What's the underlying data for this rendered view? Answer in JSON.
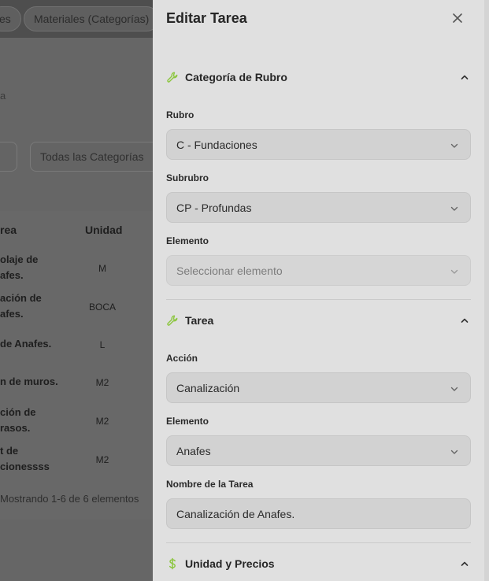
{
  "background": {
    "tabs": [
      "es",
      "Materiales (Categorías)"
    ],
    "breadcrumb_fragment": "a",
    "filter_placeholder": "Todas las Categorías",
    "table": {
      "headers": [
        "rea",
        "Unidad"
      ],
      "rows": [
        {
          "task": "olaje de\nafes.",
          "unit": "M"
        },
        {
          "task": "ación de\nafes.",
          "unit": "BOCA"
        },
        {
          "task": "de Anafes.",
          "unit": "L"
        },
        {
          "task": "n de muros.",
          "unit": "M2"
        },
        {
          "task": "ción de\nrasos.",
          "unit": "M2"
        },
        {
          "task": "t de\ncionessss",
          "unit": "M2"
        }
      ]
    },
    "footer": "Mostrando 1-6 de 6 elementos"
  },
  "panel": {
    "title": "Editar Tarea",
    "close_icon": "close-icon",
    "sections": {
      "categoria": {
        "title": "Categoría de Rubro",
        "icon": "wrench-icon",
        "rubro_label": "Rubro",
        "rubro_value": "C - Fundaciones",
        "subrubro_label": "Subrubro",
        "subrubro_value": "CP - Profundas",
        "elemento_label": "Elemento",
        "elemento_placeholder": "Seleccionar elemento"
      },
      "tarea": {
        "title": "Tarea",
        "icon": "wrench-icon",
        "accion_label": "Acción",
        "accion_value": "Canalización",
        "elemento_label": "Elemento",
        "elemento_value": "Anafes",
        "nombre_label": "Nombre de la Tarea",
        "nombre_value": "Canalización de Anafes."
      },
      "unidad": {
        "title": "Unidad y Precios",
        "icon": "dollar-icon"
      }
    }
  },
  "colors": {
    "accent": "#8cc63f",
    "panel_bg": "#e0e0e0",
    "overlay_bg": "#666666"
  }
}
